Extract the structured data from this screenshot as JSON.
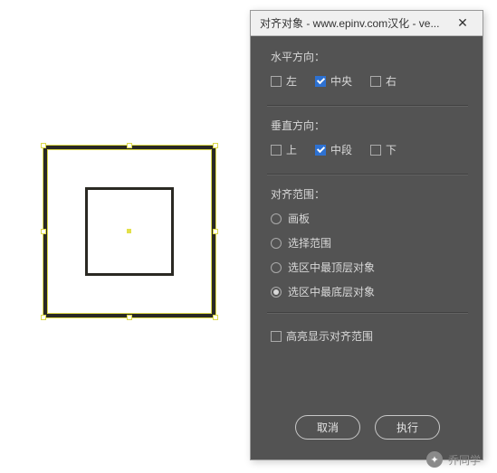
{
  "dialog": {
    "title": "对齐对象 - www.epinv.com汉化 - ve...",
    "close_label": "✕",
    "horizontal": {
      "label": "水平方向：",
      "options": [
        {
          "label": "左",
          "checked": false
        },
        {
          "label": "中央",
          "checked": true
        },
        {
          "label": "右",
          "checked": false
        }
      ]
    },
    "vertical": {
      "label": "垂直方向：",
      "options": [
        {
          "label": "上",
          "checked": false
        },
        {
          "label": "中段",
          "checked": true
        },
        {
          "label": "下",
          "checked": false
        }
      ]
    },
    "scope": {
      "label": "对齐范围：",
      "options": [
        {
          "label": "画板",
          "selected": false
        },
        {
          "label": "选择范围",
          "selected": false
        },
        {
          "label": "选区中最顶层对象",
          "selected": false
        },
        {
          "label": "选区中最底层对象",
          "selected": true
        }
      ]
    },
    "highlight": {
      "label": "高亮显示对齐范围",
      "checked": false
    },
    "buttons": {
      "cancel": "取消",
      "execute": "执行"
    }
  },
  "watermark": {
    "text": "乔同学"
  }
}
